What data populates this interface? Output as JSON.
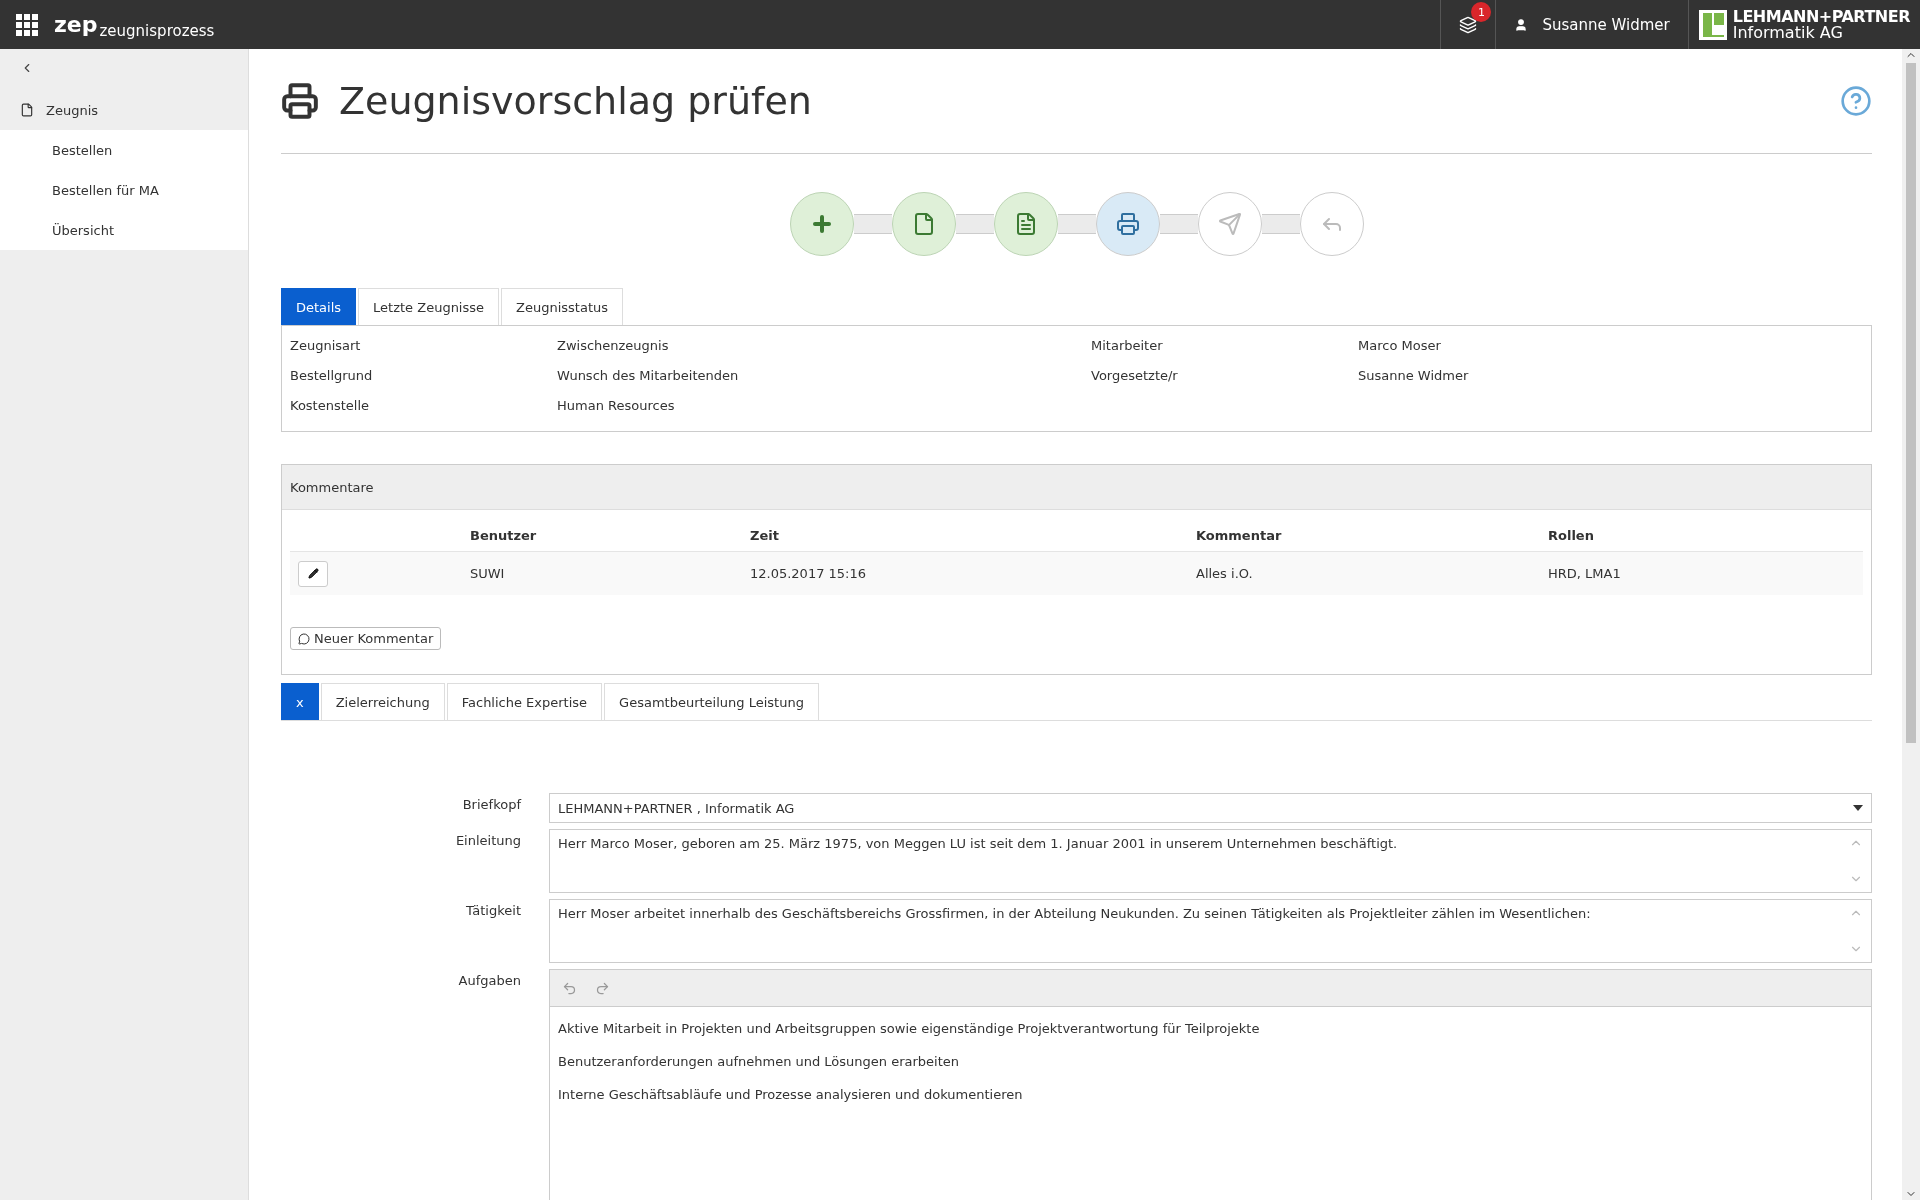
{
  "topbar": {
    "app_name": "zep",
    "app_sub": "zeugnisprozess",
    "notification_count": "1",
    "user": "Susanne Widmer",
    "logo": {
      "line1": "LEHMANN+PARTNER",
      "line2": "Informatik AG"
    }
  },
  "sidebar": {
    "items": [
      {
        "label": "Zeugnis",
        "kind": "section",
        "selected": false
      },
      {
        "label": "Bestellen",
        "kind": "link",
        "selected": false
      },
      {
        "label": "Bestellen für MA",
        "kind": "link",
        "selected": false
      },
      {
        "label": "Übersicht",
        "kind": "link",
        "selected": false
      }
    ]
  },
  "page_title": "Zeugnisvorschlag prüfen",
  "steps": [
    {
      "kind": "add",
      "completed": true,
      "selected": false
    },
    {
      "kind": "file",
      "completed": true,
      "selected": false
    },
    {
      "kind": "file-text",
      "completed": true,
      "selected": false
    },
    {
      "kind": "print",
      "completed": false,
      "selected": true
    },
    {
      "kind": "send",
      "completed": false,
      "selected": false
    },
    {
      "kind": "reply",
      "completed": false,
      "selected": false
    }
  ],
  "tabs": [
    {
      "label": "Details",
      "selected": true
    },
    {
      "label": "Letzte Zeugnisse",
      "selected": false
    },
    {
      "label": "Zeugnisstatus",
      "selected": false
    }
  ],
  "details": [
    [
      {
        "label": "Zeugnisart",
        "value": "Zwischenzeugnis"
      },
      {
        "label": "Mitarbeiter",
        "value": "Marco Moser"
      }
    ],
    [
      {
        "label": "Bestellgrund",
        "value": "Wunsch des Mitarbeitenden"
      },
      {
        "label": "Vorgesetzte/r",
        "value": "Susanne Widmer"
      }
    ],
    [
      {
        "label": "Kostenstelle",
        "value": "Human Resources"
      }
    ]
  ],
  "comments": {
    "title": "Kommentare",
    "columns": [
      "Benutzer",
      "Zeit",
      "Kommentar",
      "Rollen"
    ],
    "rows": [
      [
        "SUWI",
        "12.05.2017 15:16",
        "Alles i.O.",
        "HRD, LMA1"
      ]
    ],
    "new_button": "Neuer Kommentar"
  },
  "section_tabs": [
    {
      "label": "x",
      "selected": true
    },
    {
      "label": "Zielerreichung",
      "selected": false
    },
    {
      "label": "Fachliche Expertise",
      "selected": false
    },
    {
      "label": "Gesamtbeurteilung Leistung",
      "selected": false
    }
  ],
  "form": [
    {
      "kind": "select",
      "label": "Briefkopf",
      "value": "LEHMANN+PARTNER , Informatik AG"
    },
    {
      "kind": "textarea",
      "label": "Einleitung",
      "value": "Herr Marco Moser, geboren am 25. März 1975, von Meggen LU ist seit dem 1. Januar 2001 in unserem Unternehmen beschäftigt."
    },
    {
      "kind": "textarea",
      "label": "Tätigkeit",
      "value": "Herr Moser arbeitet innerhalb des Geschäftsbereichs Grossfirmen, in der Abteilung Neukunden. Zu seinen Tätigkeiten als Projektleiter zählen im Wesentlichen:"
    },
    {
      "kind": "editor",
      "label": "Aufgaben",
      "lines": [
        "Aktive Mitarbeit in Projekten und Arbeitsgruppen sowie eigenständige Projektverantwortung für Teilprojekte",
        "Benutzeranforderungen aufnehmen und Lösungen erarbeiten",
        "Interne Geschäftsabläufe und Prozesse analysieren und dokumentieren"
      ]
    }
  ]
}
